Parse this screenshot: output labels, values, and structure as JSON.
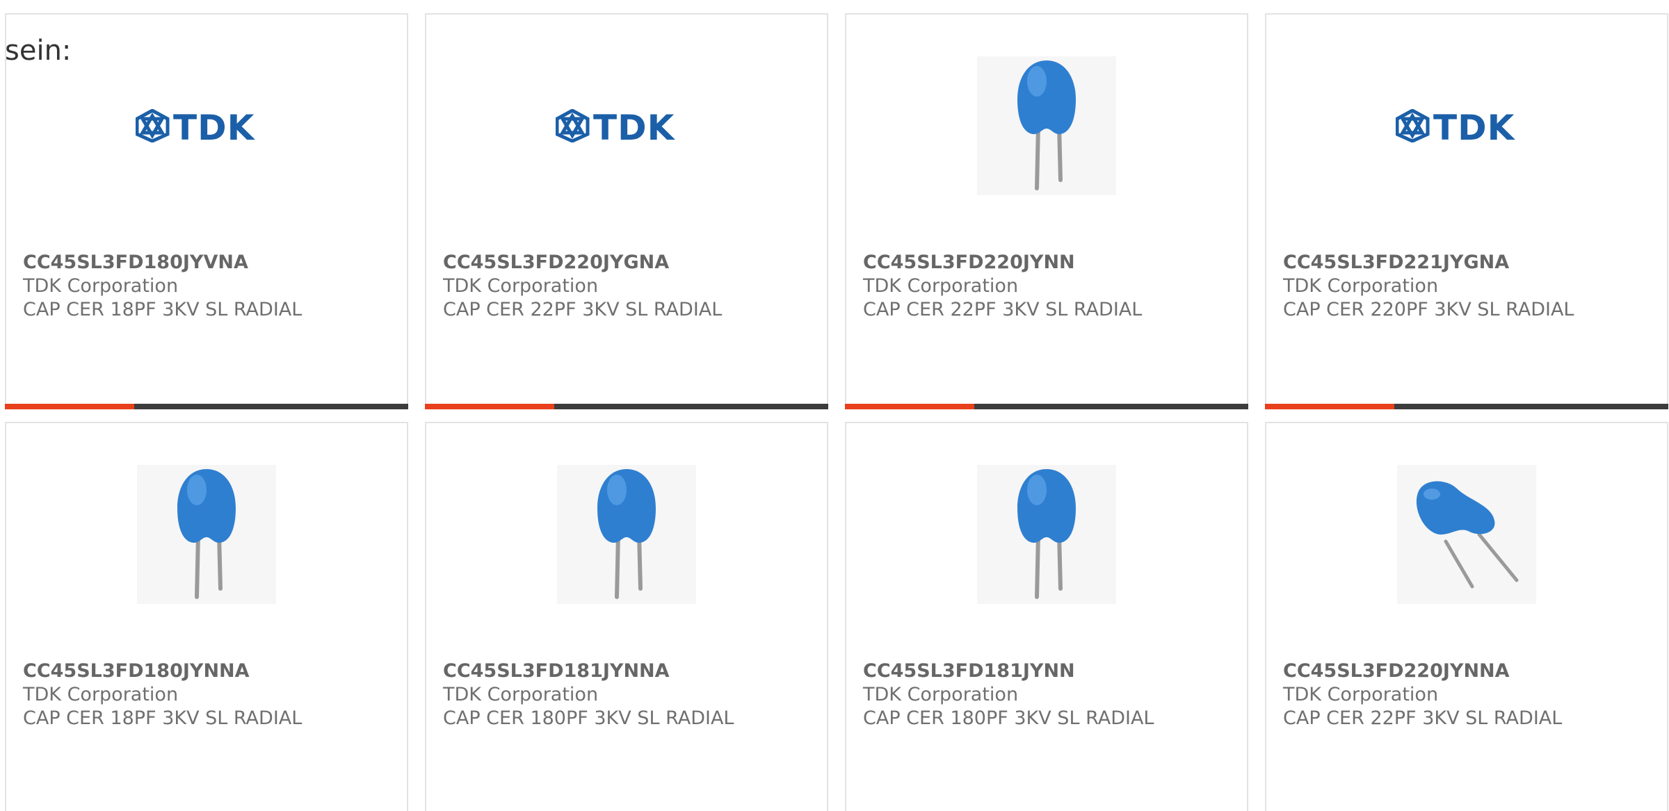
{
  "overlay": {
    "text": "sein:"
  },
  "brand_colors": {
    "accent": "#e8401c",
    "track": "#3c3c3c",
    "tdk_blue": "#1b5fa8",
    "capacitor_blue": "#2f7fd0"
  },
  "logo": {
    "text": "TDK"
  },
  "cards": [
    {
      "part_number": "CC45SL3FD180JYVNA",
      "manufacturer": "TDK Corporation",
      "description": "CAP CER 18PF 3KV SL RADIAL",
      "image": "tdk-logo",
      "progress": 0.32
    },
    {
      "part_number": "CC45SL3FD220JYGNA",
      "manufacturer": "TDK Corporation",
      "description": "CAP CER 22PF 3KV SL RADIAL",
      "image": "tdk-logo",
      "progress": 0.32
    },
    {
      "part_number": "CC45SL3FD220JYNN",
      "manufacturer": "TDK Corporation",
      "description": "CAP CER 22PF 3KV SL RADIAL",
      "image": "capacitor-upright",
      "progress": 0.32
    },
    {
      "part_number": "CC45SL3FD221JYGNA",
      "manufacturer": "TDK Corporation",
      "description": "CAP CER 220PF 3KV SL RADIAL",
      "image": "tdk-logo",
      "progress": 0.32
    },
    {
      "part_number": "CC45SL3FD180JYNNA",
      "manufacturer": "TDK Corporation",
      "description": "CAP CER 18PF 3KV SL RADIAL",
      "image": "capacitor-upright",
      "progress": null
    },
    {
      "part_number": "CC45SL3FD181JYNNA",
      "manufacturer": "TDK Corporation",
      "description": "CAP CER 180PF 3KV SL RADIAL",
      "image": "capacitor-upright",
      "progress": null
    },
    {
      "part_number": "CC45SL3FD181JYNN",
      "manufacturer": "TDK Corporation",
      "description": "CAP CER 180PF 3KV SL RADIAL",
      "image": "capacitor-upright",
      "progress": null
    },
    {
      "part_number": "CC45SL3FD220JYNNA",
      "manufacturer": "TDK Corporation",
      "description": "CAP CER 22PF 3KV SL RADIAL",
      "image": "capacitor-tilted",
      "progress": null
    }
  ]
}
